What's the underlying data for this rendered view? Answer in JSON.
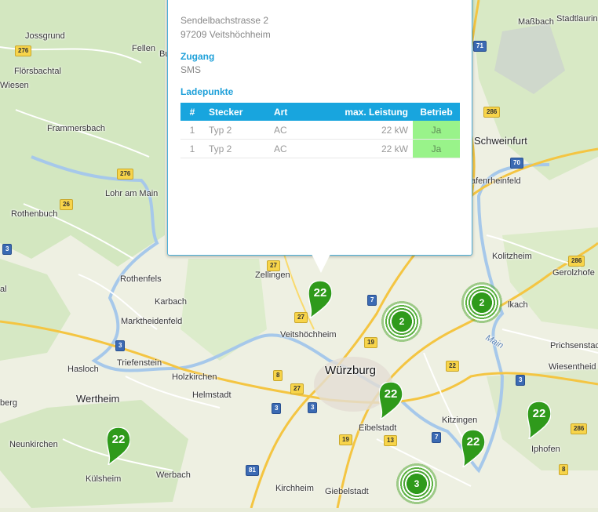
{
  "map": {
    "places": {
      "jossgrund": "Jossgrund",
      "fellen": "Fellen",
      "burgsinn_cut": "Bu",
      "floersbachtal": "Flörsbachtal",
      "wiesen": "Wiesen",
      "frammersbach": "Frammersbach",
      "lohr": "Lohr am Main",
      "rothenbuch": "Rothenbuch",
      "rothenfels": "Rothenfels",
      "karbach": "Karbach",
      "marktheidenfeld": "Marktheidenfeld",
      "triefenstein": "Triefenstein",
      "hasloch": "Hasloch",
      "holzkirchen": "Holzkirchen",
      "helmstadt": "Helmstadt",
      "wertheim": "Wertheim",
      "berg_cut": "berg",
      "neunkirchen": "Neunkirchen",
      "kuelsheim": "Külsheim",
      "werbach": "Werbach",
      "zellingen": "Zellingen",
      "veitshoechheim": "Veitshöchheim",
      "wuerzburg": "Würzburg",
      "eibelstadt": "Eibelstadt",
      "kitzingen": "Kitzingen",
      "iphofen": "Iphofen",
      "kirchheim": "Kirchheim",
      "giebelstadt": "Giebelstadt",
      "schweinfurt": "Schweinfurt",
      "mainbernheim_cut": "afenrheinfeld",
      "kolitzheim": "Kolitzheim",
      "gerolzhofen_cut": "Gerolzhofe",
      "volkach_cut": "lkach",
      "prichsenstadt_cut": "Prichsenstac",
      "wiesentheid": "Wiesentheid",
      "massbach": "Maßbach",
      "stadtlauringen_cut": "Stadtlaurin",
      "main_river": "Main",
      "left_edge_cut": "al"
    },
    "road_shields": {
      "s276a": "276",
      "s276b": "276",
      "s26": "26",
      "s3a": "3",
      "s27a": "27",
      "s27b": "27",
      "s7": "7",
      "s19a": "19",
      "s3b": "3",
      "s8": "8",
      "s27c": "27",
      "s3c": "3",
      "s3d": "3",
      "s22": "22",
      "s3e": "3",
      "s19b": "19",
      "s13": "13",
      "s7b": "7",
      "s81": "81",
      "s286a": "286",
      "s286b": "286",
      "s286c": "286",
      "s70": "70",
      "s71": "71",
      "s8b": "8"
    },
    "clusters": {
      "c1": "2",
      "c2": "2",
      "c3": "3"
    },
    "pin_label": "22"
  },
  "popup": {
    "street": "Sendelbachstrasse 2",
    "city": "97209 Veitshöchheim",
    "access_heading": "Zugang",
    "access_value": "SMS",
    "points_heading": "Ladepunkte",
    "columns": [
      "#",
      "Stecker",
      "Art",
      "max. Leistung",
      "Betrieb"
    ],
    "rows": [
      {
        "num": "1",
        "plug": "Typ 2",
        "type": "AC",
        "power": "22 kW",
        "operation": "Ja"
      },
      {
        "num": "1",
        "plug": "Typ 2",
        "type": "AC",
        "power": "22 kW",
        "operation": "Ja"
      }
    ],
    "accent_color": "#18a5de",
    "operation_ok_color": "#99f38a"
  },
  "colors": {
    "marker_green": "#2f9a1b",
    "river": "#a6c8ea",
    "road_major": "#f4c542"
  }
}
